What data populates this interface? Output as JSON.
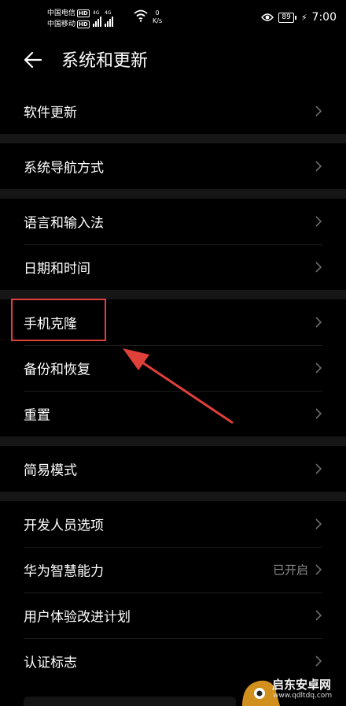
{
  "status_bar": {
    "carrier1": "中国电信",
    "carrier2": "中国移动",
    "hd_badge": "HD",
    "network1": "4G",
    "network2": "4G",
    "speed_value": "0",
    "speed_unit": "K/s",
    "battery": "89",
    "time": "7:00"
  },
  "header": {
    "title": "系统和更新"
  },
  "groups": [
    {
      "items": [
        {
          "label": "软件更新"
        }
      ]
    },
    {
      "items": [
        {
          "label": "系统导航方式"
        }
      ]
    },
    {
      "items": [
        {
          "label": "语言和输入法"
        },
        {
          "label": "日期和时间"
        }
      ]
    },
    {
      "items": [
        {
          "label": "手机克隆"
        },
        {
          "label": "备份和恢复"
        },
        {
          "label": "重置"
        }
      ]
    },
    {
      "items": [
        {
          "label": "简易模式"
        }
      ]
    },
    {
      "items": [
        {
          "label": "开发人员选项"
        },
        {
          "label": "华为智慧能力",
          "value": "已开启"
        },
        {
          "label": "用户体验改进计划"
        },
        {
          "label": "认证标志"
        }
      ]
    }
  ],
  "watermark": {
    "name": "启东安卓网",
    "url": "www.qdltdq.com"
  },
  "colors": {
    "background": "#000000",
    "annotation": "#e0403a",
    "secondary_text": "#8a8a8a"
  }
}
